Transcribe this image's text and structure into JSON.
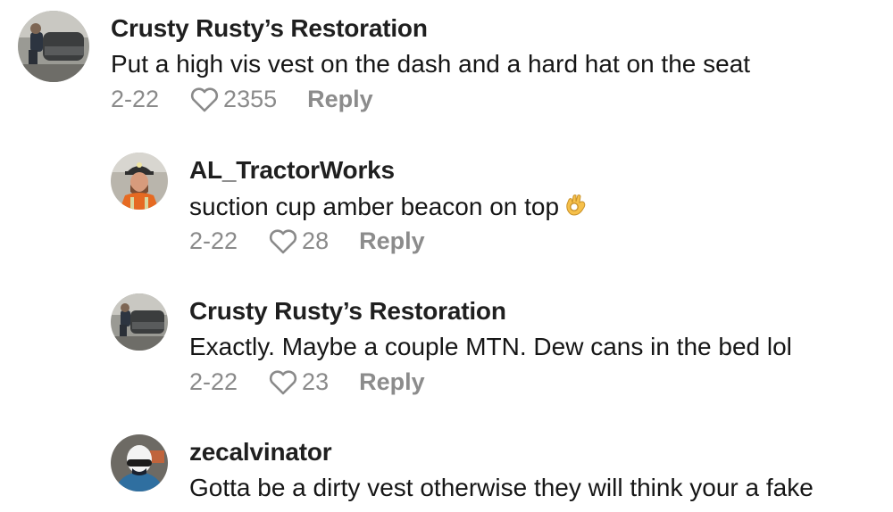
{
  "comments": [
    {
      "username": "Crusty Rusty’s Restoration",
      "text": "Put a high vis vest on the dash and a hard hat on the seat",
      "date": "2-22",
      "likes": "2355",
      "reply_label": "Reply",
      "avatar": "truck-avatar"
    },
    {
      "username": "AL_TractorWorks",
      "text": "suction cup amber beacon on top",
      "emoji": "ok-hand-emoji",
      "date": "2-22",
      "likes": "28",
      "reply_label": "Reply",
      "avatar": "hardhat-avatar"
    },
    {
      "username": "Crusty Rusty’s Restoration",
      "text": "Exactly. Maybe a couple MTN. Dew cans in the bed lol",
      "date": "2-22",
      "likes": "23",
      "reply_label": "Reply",
      "avatar": "truck-avatar"
    },
    {
      "username": "zecalvinator",
      "text": "Gotta be a dirty vest otherwise they will think your a fake",
      "avatar": "helmet-avatar"
    }
  ],
  "colors": {
    "username": "#1f1f1f",
    "meta": "#8a8a8a",
    "background": "#ffffff"
  }
}
